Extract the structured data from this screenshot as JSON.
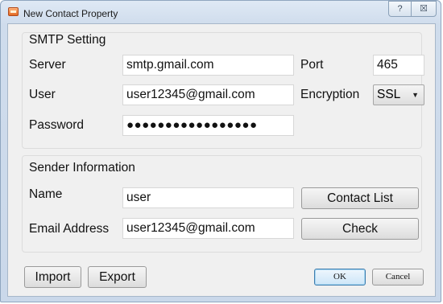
{
  "window": {
    "title": "New Contact Property",
    "help_label": "?",
    "close_label": "☒"
  },
  "smtp": {
    "section_label": "SMTP Setting",
    "server_label": "Server",
    "server_value": "smtp.gmail.com",
    "port_label": "Port",
    "port_value": "465",
    "user_label": "User",
    "user_value": "user12345@gmail.com",
    "encryption_label": "Encryption",
    "encryption_value": "SSL",
    "encryption_arrow": "▼",
    "password_label": "Password",
    "password_value": "●●●●●●●●●●●●●●●●●"
  },
  "sender": {
    "section_label": "Sender Information",
    "name_label": "Name",
    "name_value": "user",
    "email_label": "Email Address",
    "email_value": "user12345@gmail.com",
    "contact_list_label": "Contact List",
    "check_label": "Check"
  },
  "footer": {
    "import_label": "Import",
    "export_label": "Export",
    "ok_label": "OK",
    "cancel_label": "Cancel"
  }
}
